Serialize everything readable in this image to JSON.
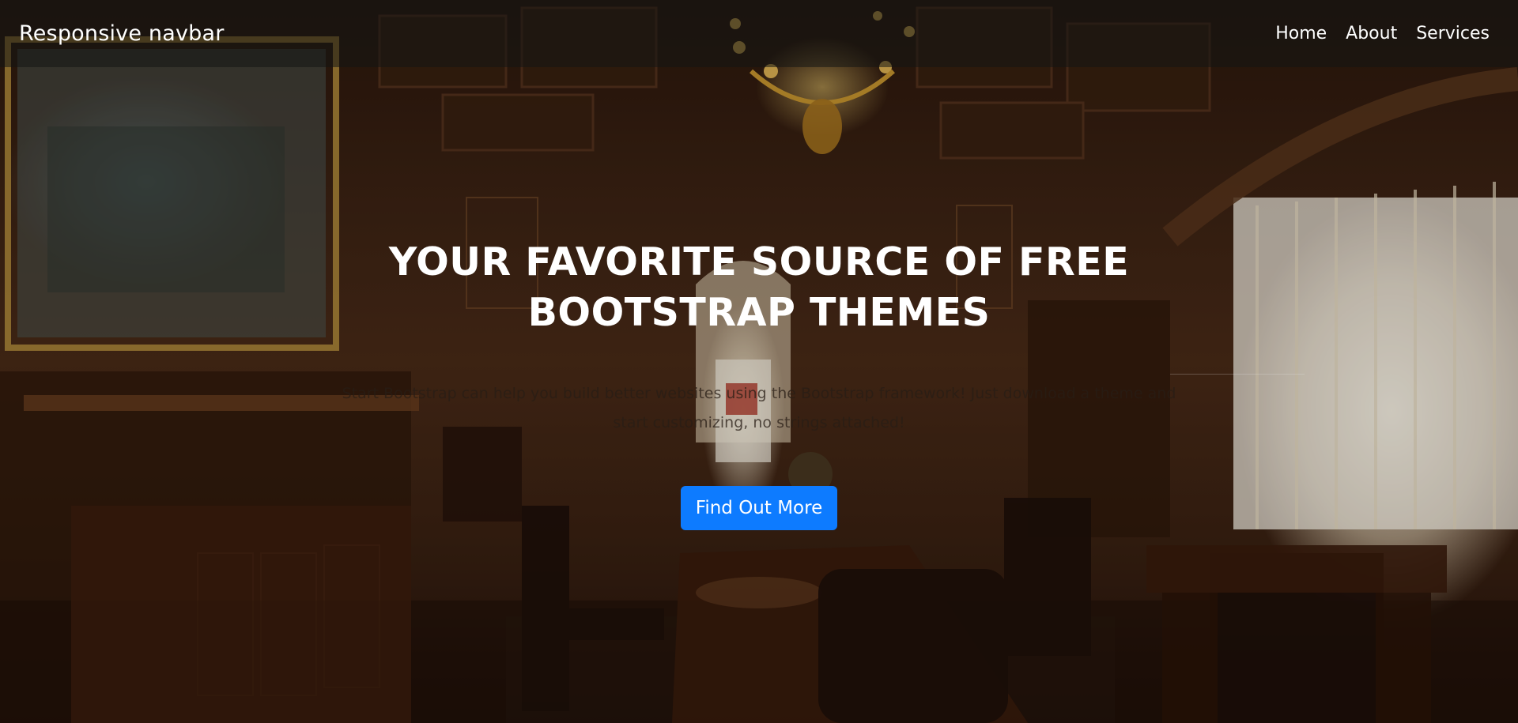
{
  "navbar": {
    "brand": "Responsive navbar",
    "links": [
      "Home",
      "About",
      "Services"
    ]
  },
  "masthead": {
    "title": "YOUR FAVORITE SOURCE OF FREE BOOTSTRAP THEMES",
    "subtitle": "Start Bootstrap can help you build better websites using the Bootstrap framework! Just download a theme and start customizing, no strings attached!",
    "button_label": "Find Out More"
  },
  "colors": {
    "button": "#0d7bff",
    "nav_background": "rgba(20,22,20,0.55)",
    "text": "#ffffff"
  }
}
